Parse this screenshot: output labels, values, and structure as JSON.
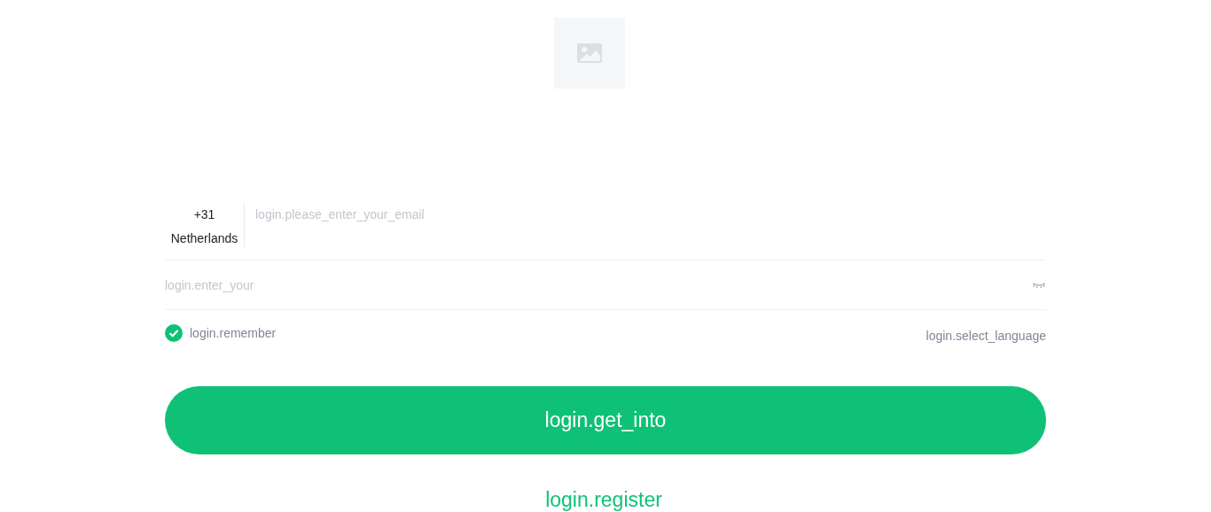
{
  "country": {
    "code": "+31",
    "name": "Netherlands"
  },
  "email": {
    "placeholder": "login.please_enter_your_email"
  },
  "password": {
    "placeholder": "login.enter_your",
    "visible": false
  },
  "remember": {
    "label": "login.remember",
    "checked": true
  },
  "language_link": "login.select_language",
  "submit_button": "login.get_into",
  "register_link": "login.register"
}
